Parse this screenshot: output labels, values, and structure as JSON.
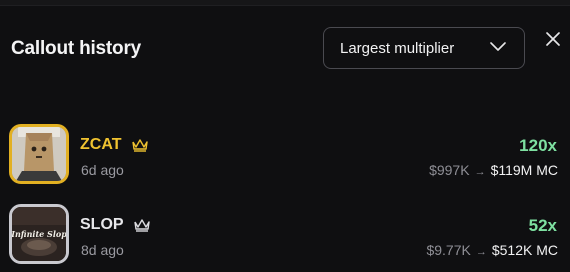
{
  "header": {
    "title": "Callout history",
    "sort": {
      "selected": "Largest multiplier"
    }
  },
  "callouts": [
    {
      "name": "ZCAT",
      "time_ago": "6d ago",
      "multiplier": "120x",
      "mc_from": "$997K",
      "arrow": "→",
      "mc_to": "$119M MC",
      "rank_color": "#e2b022"
    },
    {
      "name": "SLOP",
      "time_ago": "8d ago",
      "multiplier": "52x",
      "mc_from": "$9.77K",
      "arrow": "→",
      "mc_to": "$512K MC",
      "rank_color": "#c9c9cf",
      "avatar_text": "Infinite Slop"
    }
  ],
  "colors": {
    "multiplier": "#7ee0a1",
    "gold": "#f0c330",
    "muted": "#9a9aa1"
  },
  "icons": [
    "chevron-down-icon",
    "close-icon",
    "crown-icon"
  ]
}
